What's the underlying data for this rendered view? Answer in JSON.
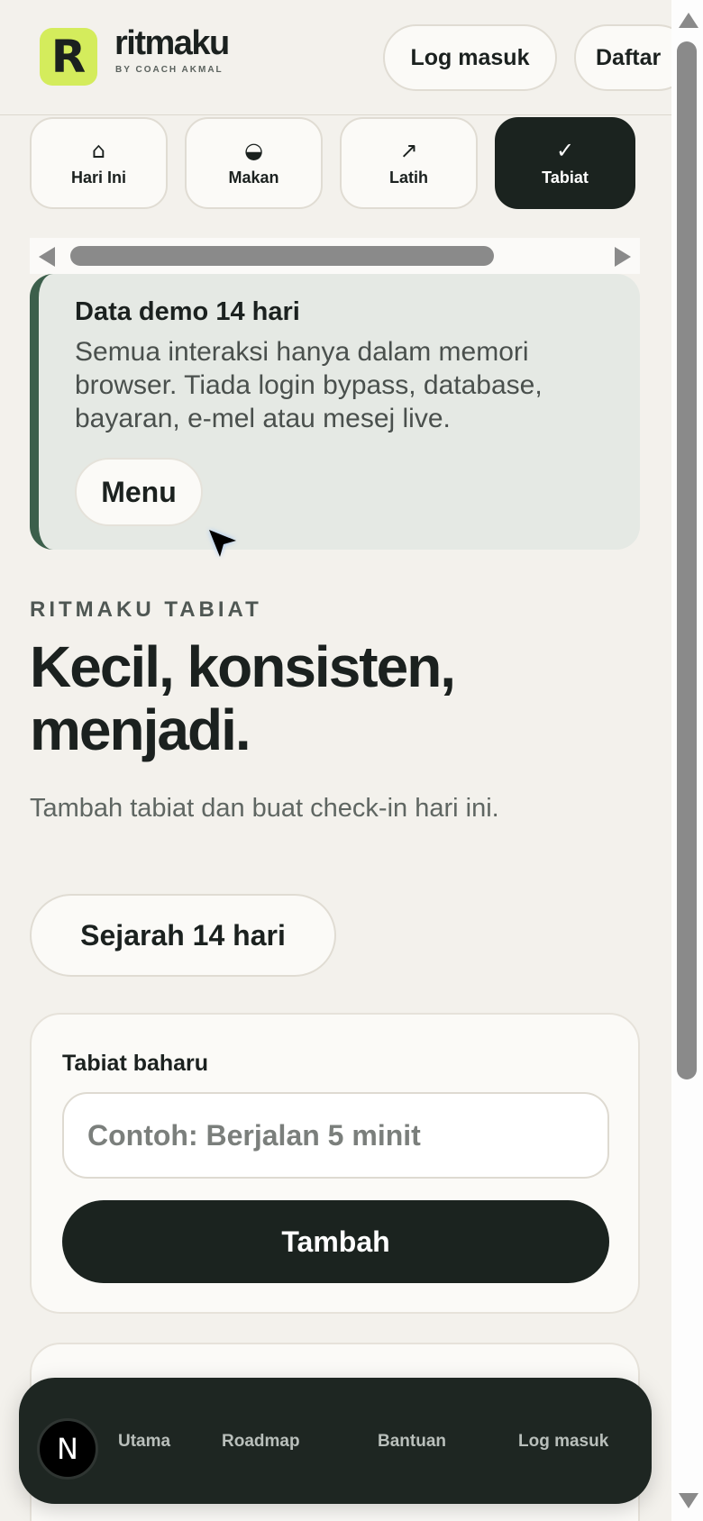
{
  "brand": {
    "logo_letter": "R",
    "name": "ritmaku",
    "tagline": "BY COACH AKMAL",
    "accent": "#d4ec5c"
  },
  "header": {
    "login_label": "Log masuk",
    "signup_label": "Daftar"
  },
  "tabs": [
    {
      "icon": "⌂",
      "icon_name": "home-icon",
      "label": "Hari Ini",
      "active": false
    },
    {
      "icon": "◒",
      "icon_name": "half-circle-icon",
      "label": "Makan",
      "active": false
    },
    {
      "icon": "↗",
      "icon_name": "arrow-up-right-icon",
      "label": "Latih",
      "active": false
    },
    {
      "icon": "✓",
      "icon_name": "check-icon",
      "label": "Tabiat",
      "active": true
    }
  ],
  "notice": {
    "title": "Data demo 14 hari",
    "body": "Semua interaksi hanya dalam memori browser. Tiada login bypass, database, bayaran, e-mel atau mesej live.",
    "menu_label": "Menu"
  },
  "hero": {
    "eyebrow": "RITMAKU TABIAT",
    "title": "Kecil, konsisten, menjadi.",
    "subtitle": "Tambah tabiat dan buat check-in hari ini.",
    "history_label": "Sejarah 14 hari"
  },
  "form": {
    "label": "Tabiat baharu",
    "placeholder": "Contoh: Berjalan 5 minit",
    "value": "",
    "submit_label": "Tambah"
  },
  "bottom_nav": {
    "badge": "N",
    "items": [
      "Utama",
      "Roadmap",
      "Bantuan",
      "Log masuk"
    ]
  },
  "colors": {
    "dark": "#1b231f",
    "background": "#f3f1ec",
    "notice_border": "#3c5f4b"
  }
}
